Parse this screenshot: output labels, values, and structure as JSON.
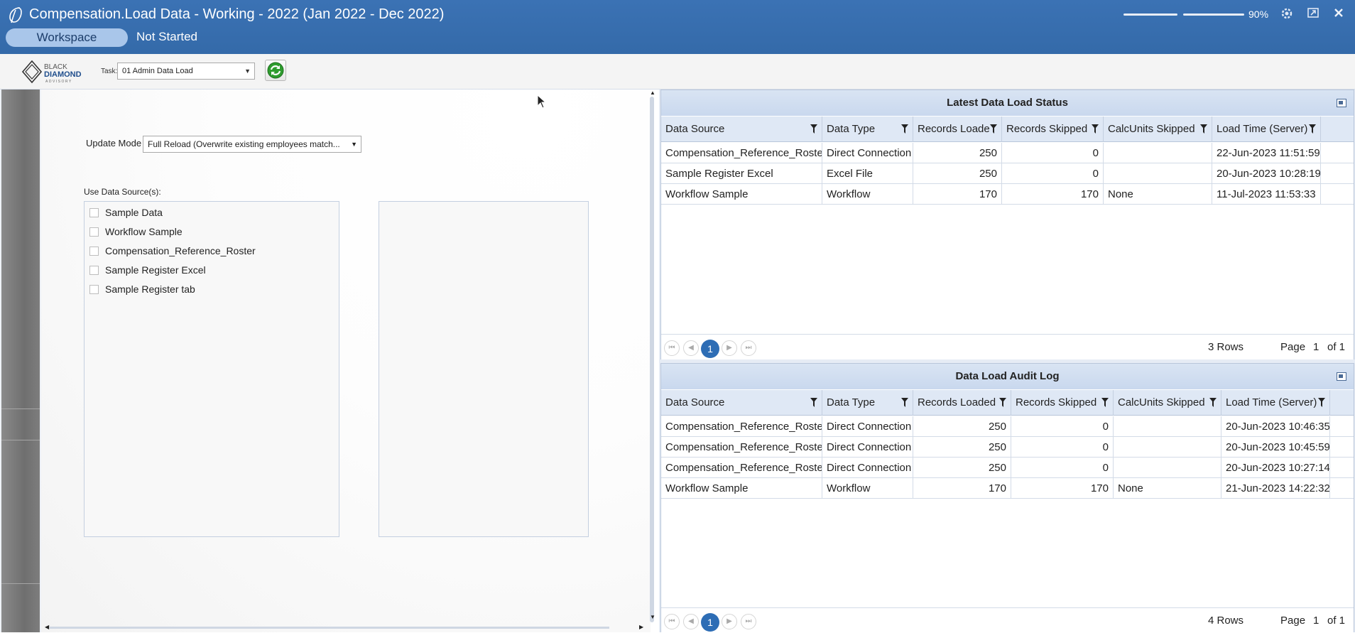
{
  "window": {
    "title": "Compensation.Load Data  -  Working  -  2022 (Jan 2022 - Dec 2022)",
    "workspace_label": "Workspace",
    "status": "Not Started",
    "zoom": "90%"
  },
  "toolbar": {
    "logo_line1": "BLACK",
    "logo_line2": "DIAMOND",
    "logo_line3": "ADVISORY",
    "task_label": "Task:",
    "task_value": "01 Admin Data Load"
  },
  "form": {
    "update_mode_label": "Update Mode",
    "update_mode_value": "Full Reload (Overwrite existing employees match...",
    "use_data_sources_label": "Use Data Source(s):",
    "data_sources": [
      {
        "label": "Sample Data",
        "checked": false
      },
      {
        "label": "Workflow Sample",
        "checked": false
      },
      {
        "label": "Compensation_Reference_Roster",
        "checked": false
      },
      {
        "label": "Sample Register Excel",
        "checked": false
      },
      {
        "label": "Sample Register tab",
        "checked": false
      }
    ]
  },
  "latest_status": {
    "title": "Latest Data Load Status",
    "columns": [
      "Data Source",
      "Data Type",
      "Records Loade",
      "Records Skipped",
      "CalcUnits Skipped",
      "Load Time (Server)"
    ],
    "rows": [
      [
        "Compensation_Reference_Roster",
        "Direct Connection",
        "250",
        "0",
        "",
        "22-Jun-2023 11:51:59"
      ],
      [
        "Sample Register Excel",
        "Excel File",
        "250",
        "0",
        "",
        "20-Jun-2023 10:28:19"
      ],
      [
        "Workflow Sample",
        "Workflow",
        "170",
        "170",
        "None",
        "11-Jul-2023 11:53:33"
      ]
    ],
    "pager": {
      "current": "1",
      "rows_text": "3 Rows",
      "page_label": "Page",
      "page_num": "1",
      "of_text": "of 1"
    }
  },
  "audit_log": {
    "title": "Data Load Audit Log",
    "columns": [
      "Data Source",
      "Data Type",
      "Records Loaded",
      "Records Skipped",
      "CalcUnits Skipped",
      "Load Time (Server)"
    ],
    "rows": [
      [
        "Compensation_Reference_Roster",
        "Direct Connection",
        "250",
        "0",
        "",
        "20-Jun-2023 10:46:35"
      ],
      [
        "Compensation_Reference_Roster",
        "Direct Connection",
        "250",
        "0",
        "",
        "20-Jun-2023 10:45:59"
      ],
      [
        "Compensation_Reference_Roster",
        "Direct Connection",
        "250",
        "0",
        "",
        "20-Jun-2023 10:27:14"
      ],
      [
        "Workflow Sample",
        "Workflow",
        "170",
        "170",
        "None",
        "21-Jun-2023 14:22:32"
      ]
    ],
    "pager": {
      "current": "1",
      "rows_text": "4 Rows",
      "page_label": "Page",
      "page_num": "1",
      "of_text": "of 1"
    }
  },
  "colors": {
    "titlebar": "#3a6fb0",
    "workspace_pill": "#a9c6ea",
    "grid_header": "#dfe8f5",
    "pager_current": "#2d6db5",
    "refresh_green": "#2e9c2e"
  },
  "icons": [
    "app-logo-icon",
    "settings-icon",
    "popout-icon",
    "close-icon",
    "refresh-icon",
    "filter-icon",
    "popout-panel-icon"
  ]
}
